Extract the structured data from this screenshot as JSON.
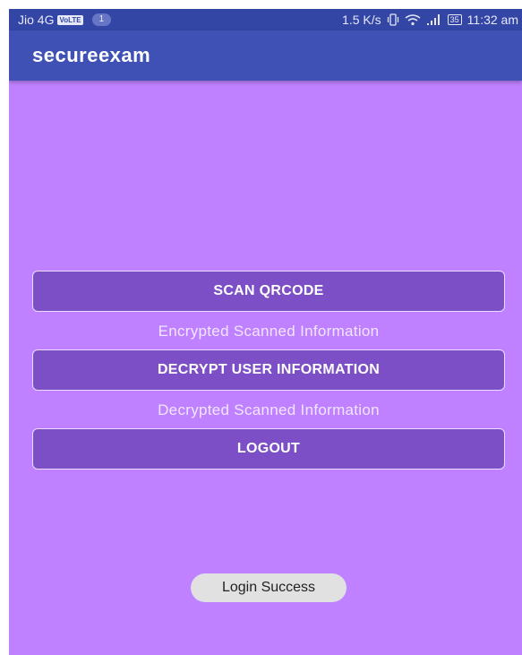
{
  "status_bar": {
    "carrier": "Jio 4G",
    "volte": "VoLTE",
    "notification_count": "1",
    "net_speed": "1.5 K/s",
    "battery": "35",
    "time": "11:32 am"
  },
  "app_bar": {
    "title": "secureexam"
  },
  "main": {
    "scan_button_label": "SCAN QRCODE",
    "encrypted_info": "Encrypted Scanned Information",
    "decrypt_button_label": "DECRYPT USER INFORMATION",
    "decrypted_info": "Decrypted Scanned Information",
    "logout_button_label": "LOGOUT"
  },
  "toast": {
    "message": "Login Success"
  },
  "colors": {
    "status_bar": "#3346a6",
    "app_bar": "#3f51b5",
    "background": "#bf81ff",
    "button": "#7d4fc6"
  }
}
